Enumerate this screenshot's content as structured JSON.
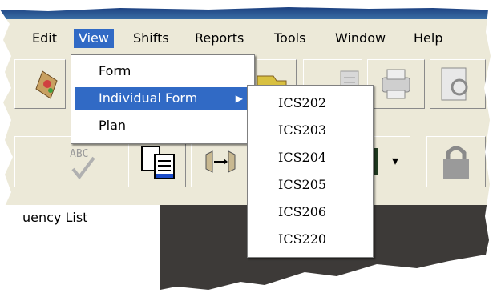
{
  "menubar": {
    "items": [
      {
        "label": "Edit"
      },
      {
        "label": "View"
      },
      {
        "label": "Shifts"
      },
      {
        "label": "Reports"
      },
      {
        "label": "Tools"
      },
      {
        "label": "Window"
      },
      {
        "label": "Help"
      }
    ],
    "selected": "View"
  },
  "view_menu": {
    "items": [
      {
        "label": "Form"
      },
      {
        "label": "Individual Form",
        "has_submenu": true,
        "submenu_arrow": "▶"
      },
      {
        "label": "Plan"
      }
    ],
    "highlighted": "Individual Form"
  },
  "submenu": {
    "items": [
      {
        "label": "ICS202"
      },
      {
        "label": "ICS203"
      },
      {
        "label": "ICS204"
      },
      {
        "label": "ICS205"
      },
      {
        "label": "ICS206"
      },
      {
        "label": "ICS220"
      }
    ]
  },
  "left_panel": {
    "label": "uency List"
  },
  "toolbar": {
    "spellcheck_text": "ABC",
    "dropdown_arrow": "▾"
  },
  "colors": {
    "highlight": "#316ac5",
    "chrome": "#ece9d8",
    "dark_area": "#3d3a38"
  }
}
